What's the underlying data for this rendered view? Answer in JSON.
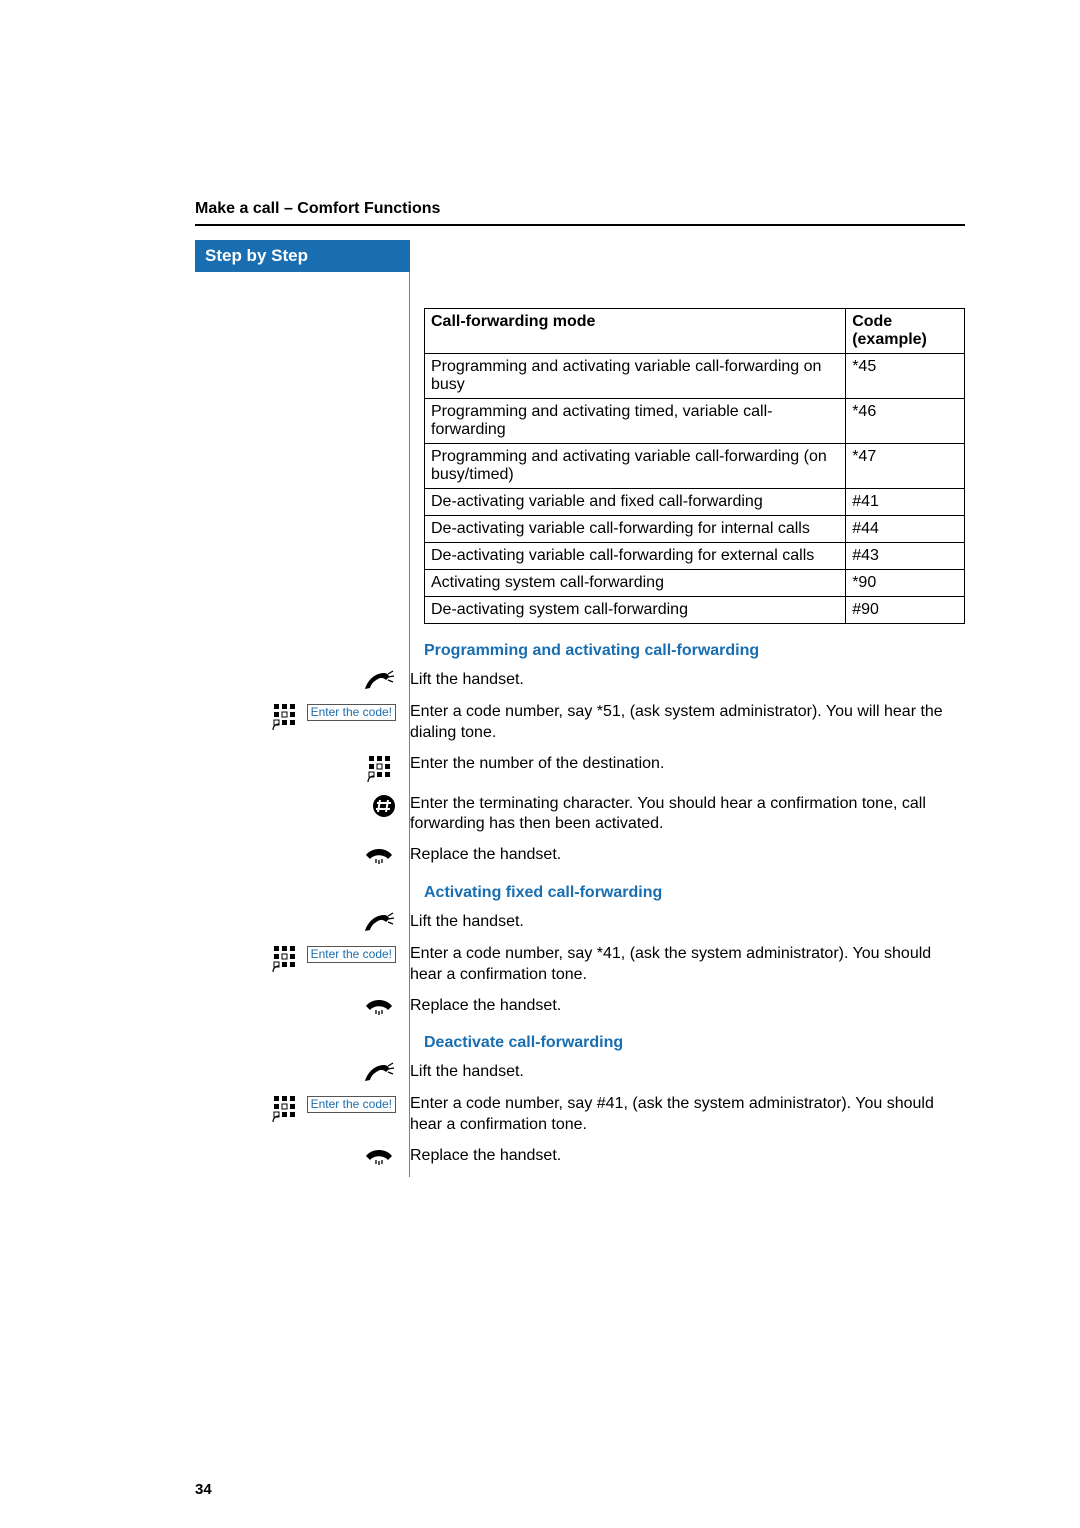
{
  "header": {
    "breadcrumb": "Make a call – Comfort Functions",
    "step_box": "Step by Step"
  },
  "table": {
    "head_mode": "Call-forwarding mode",
    "head_code": "Code (example)",
    "rows": [
      {
        "mode": "Programming and activating variable call-forwarding on busy",
        "code": "*45"
      },
      {
        "mode": "Programming and activating timed, variable call-forwarding",
        "code": "*46"
      },
      {
        "mode": "Programming and activating variable call-forwarding (on busy/timed)",
        "code": "*47"
      },
      {
        "mode": "De-activating variable and fixed call-forwarding",
        "code": "#41"
      },
      {
        "mode": "De-activating variable call-forwarding for internal calls",
        "code": "#44"
      },
      {
        "mode": "De-activating variable call-forwarding for external calls",
        "code": "#43"
      },
      {
        "mode": "Activating system call-forwarding",
        "code": "*90"
      },
      {
        "mode": "De-activating system call-forwarding",
        "code": "#90"
      }
    ]
  },
  "sections": {
    "prog_act": {
      "heading": "Programming and activating call-forwarding",
      "steps": {
        "lift": "Lift the handset.",
        "enter_code": "Enter a code number, say *51, (ask system administrator). You will hear the dialing tone.",
        "enter_dest": "Enter the number of the destination.",
        "enter_term": "Enter the terminating character. You should hear a confirmation tone, call forwarding has then been activated.",
        "replace": "Replace the handset."
      }
    },
    "act_fixed": {
      "heading": "Activating fixed call-forwarding",
      "steps": {
        "lift": "Lift the handset.",
        "enter_code": "Enter a code number, say *41, (ask the system administrator). You should hear a confirmation tone.",
        "replace": "Replace the handset."
      }
    },
    "deact": {
      "heading": "Deactivate call-forwarding",
      "steps": {
        "lift": "Lift the handset.",
        "enter_code": "Enter a code number, say #41, (ask the system administrator). You should hear a confirmation tone.",
        "replace": "Replace the handset."
      }
    }
  },
  "legend": {
    "enter_code_label": "Enter the code!"
  },
  "icons": {
    "lift": "lift-handset-icon",
    "keypad": "keypad-icon",
    "hash": "hash-key-icon",
    "replace": "replace-handset-icon"
  },
  "page_number": "34"
}
